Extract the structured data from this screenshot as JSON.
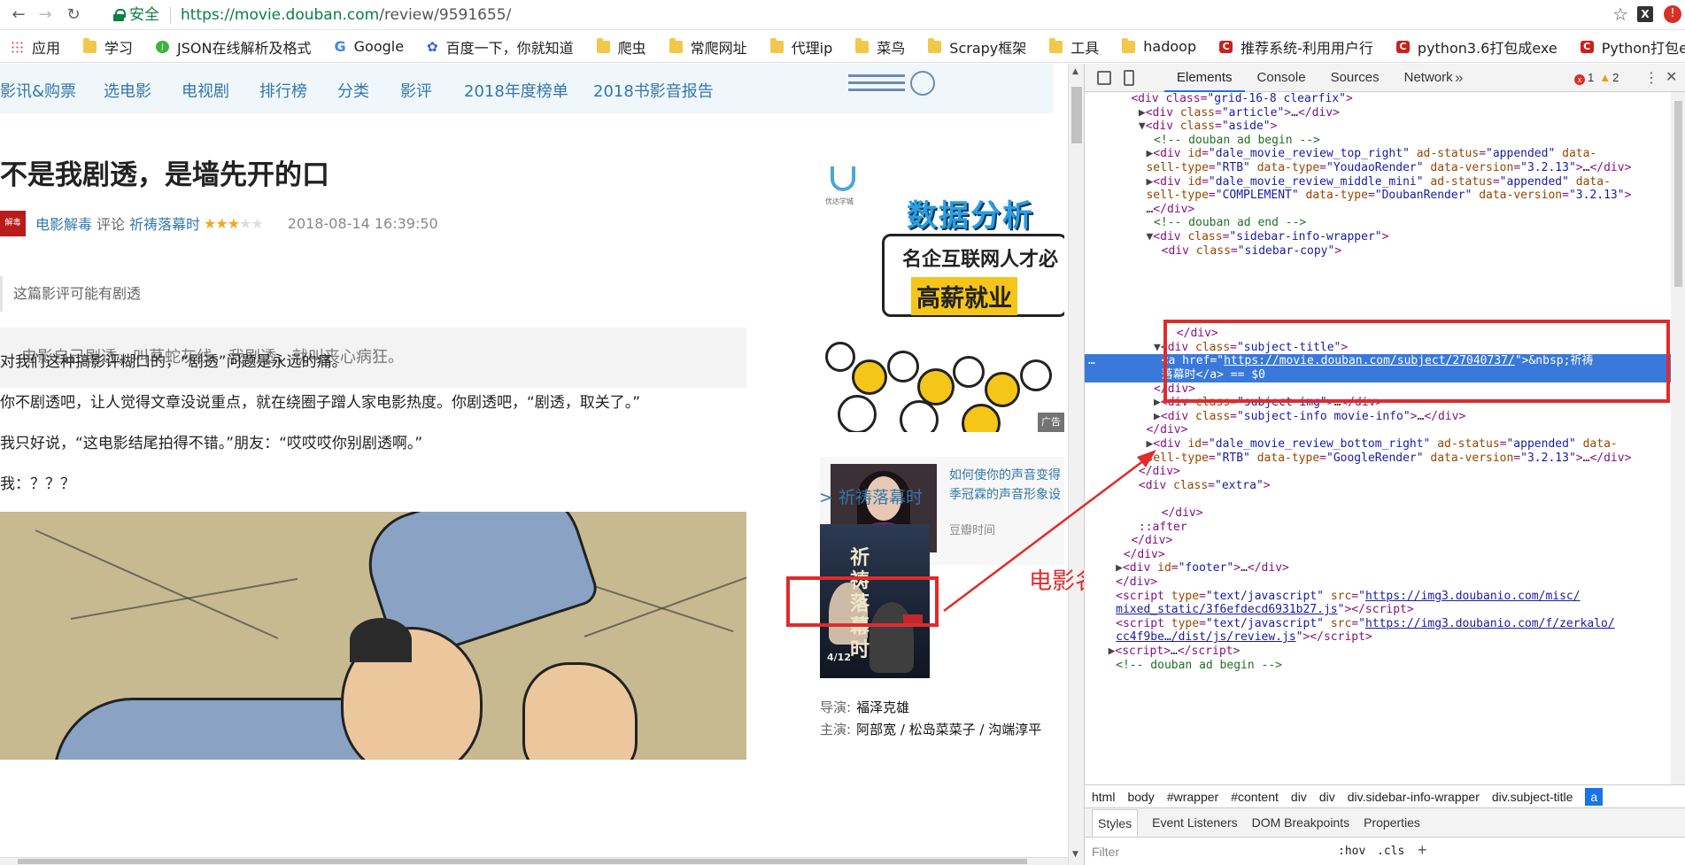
{
  "browser": {
    "secure_label": "安全",
    "url_host": "https://movie.douban.com",
    "url_path": "/review/9591655/",
    "bookmarks": [
      {
        "label": "应用",
        "icon": "apps-grid-icon"
      },
      {
        "label": "学习",
        "icon": "folder-icon"
      },
      {
        "label": "JSON在线解析及格式",
        "icon": "json-site-icon"
      },
      {
        "label": "Google",
        "icon": "google-icon"
      },
      {
        "label": "百度一下，你就知道",
        "icon": "baidu-icon"
      },
      {
        "label": "爬虫",
        "icon": "folder-icon"
      },
      {
        "label": "常爬网址",
        "icon": "folder-icon"
      },
      {
        "label": "代理ip",
        "icon": "folder-icon"
      },
      {
        "label": "菜鸟",
        "icon": "folder-icon"
      },
      {
        "label": "Scrapy框架",
        "icon": "folder-icon"
      },
      {
        "label": "工具",
        "icon": "folder-icon"
      },
      {
        "label": "hadoop",
        "icon": "folder-icon"
      },
      {
        "label": "推荐系统-利用用户行",
        "icon": "csdn-icon"
      },
      {
        "label": "python3.6打包成exe",
        "icon": "csdn-icon"
      },
      {
        "label": "Python打包exe文件",
        "icon": "csdn-icon"
      }
    ]
  },
  "page": {
    "nav": [
      "影讯&购票",
      "选电影",
      "电视剧",
      "排行榜",
      "分类",
      "影评",
      "2018年度榜单",
      "2018书影音报告"
    ],
    "review_title": "不是我剧透，是墙先开的口",
    "avatar_text": "解毒",
    "author": "电影解毒",
    "review_word": "评论",
    "movie": "祈祷落幕时",
    "rating": 3,
    "rating_max": 5,
    "date": "2018-08-14 16:39:50",
    "spoiler": "这篇影评可能有剧透",
    "quote": "电影自己剧透，叫草蛇灰线。我剧透，就叫丧心病狂。",
    "paragraphs": [
      "对我们这种搞影评糊口的，“剧透”问题是永远的痛。",
      "你不剧透吧，让人觉得文章没说重点，就在绕圈子蹭人家电影热度。你剧透吧，“剧透，取关了。”",
      "我只好说，“这电影结尾拍得不错。”朋友：“哎哎哎你别剧透啊。”",
      "我：？？？"
    ],
    "sidebar": {
      "ad_logo_text": "优达学城",
      "ad_title": "数据分析师",
      "ad_sub1": "名企互联网人才必",
      "ad_sub2": "高薪就业",
      "ad_badge": "广告",
      "ad2_line1": "如何使你的声音变得",
      "ad2_line2": "季冠霖的声音形象设",
      "ad2_source": "豆瓣时间",
      "subject_title": "> 祈祷落幕时",
      "poster_title": "祈祷落幕时",
      "poster_date": "4/12",
      "director_label": "导演:",
      "director": "福泽克雄",
      "cast_label": "主演:",
      "cast": "阿部宽 / 松岛菜菜子 / 沟端淳平"
    },
    "annotation": "电影名"
  },
  "devtools": {
    "tabs": [
      "Elements",
      "Console",
      "Sources",
      "Network"
    ],
    "more": "»",
    "errors": "1",
    "warnings": "2",
    "lines": [
      {
        "indent": 8,
        "html": "<span class='tg'>&lt;div class=</span><span class='av'>\"grid-16-8 clearfix\"</span><span class='tg'>&gt;</span>"
      },
      {
        "indent": 10,
        "tri": "▶",
        "html": "<span class='tg'>&lt;div </span><span class='an'>class</span><span class='tg'>=</span><span class='av'>\"article\"</span><span class='tg'>&gt;</span><span class='tx'>…</span><span class='tg'>&lt;/div&gt;</span>"
      },
      {
        "indent": 10,
        "tri": "▼",
        "html": "<span class='tg'>&lt;div </span><span class='an'>class</span><span class='tg'>=</span><span class='av'>\"aside\"</span><span class='tg'>&gt;</span>"
      },
      {
        "indent": 14,
        "html": "<span class='cm'>&lt;!-- douban ad begin --&gt;</span>"
      },
      {
        "indent": 12,
        "tri": "▶",
        "html": "<span class='tg'>&lt;div </span><span class='an'>id</span><span class='tg'>=</span><span class='av'>\"dale_movie_review_top_right\"</span> <span class='an'>ad-status</span><span class='tg'>=</span><span class='av'>\"appended\"</span> <span class='an'>data-</span>"
      },
      {
        "indent": 12,
        "html": "<span class='an'>sell-type</span><span class='tg'>=</span><span class='av'>\"RTB\"</span> <span class='an'>data-type</span><span class='tg'>=</span><span class='av'>\"YoudaoRender\"</span> <span class='an'>data-version</span><span class='tg'>=</span><span class='av'>\"3.2.13\"</span><span class='tg'>&gt;</span><span class='tx'>…</span><span class='tg'>&lt;/div&gt;</span>"
      },
      {
        "indent": 12,
        "tri": "▶",
        "html": "<span class='tg'>&lt;div </span><span class='an'>id</span><span class='tg'>=</span><span class='av'>\"dale_movie_review_middle_mini\"</span> <span class='an'>ad-status</span><span class='tg'>=</span><span class='av'>\"appended\"</span> <span class='an'>data-</span>"
      },
      {
        "indent": 12,
        "html": "<span class='an'>sell-type</span><span class='tg'>=</span><span class='av'>\"COMPLEMENT\"</span> <span class='an'>data-type</span><span class='tg'>=</span><span class='av'>\"DoubanRender\"</span> <span class='an'>data-version</span><span class='tg'>=</span><span class='av'>\"3.2.13\"</span><span class='tg'>&gt;</span>"
      },
      {
        "indent": 12,
        "html": "<span class='tx'>…</span><span class='tg'>&lt;/div&gt;</span>"
      },
      {
        "indent": 14,
        "html": "<span class='cm'>&lt;!-- douban ad end --&gt;</span>"
      },
      {
        "indent": 12,
        "tri": "▼",
        "html": "<span class='tg'>&lt;div </span><span class='an'>class</span><span class='tg'>=</span><span class='av'>\"sidebar-info-wrapper\"</span><span class='tg'>&gt;</span>"
      },
      {
        "indent": 16,
        "html": "<span class='tg'>&lt;div </span><span class='an'>class</span><span class='tg'>=</span><span class='av'>\"sidebar-copy\"</span><span class='tg'>&gt;</span>"
      },
      {
        "indent": 0,
        "html": ""
      },
      {
        "indent": 0,
        "html": ""
      },
      {
        "indent": 0,
        "html": ""
      },
      {
        "indent": 0,
        "html": ""
      },
      {
        "indent": 0,
        "html": ""
      },
      {
        "indent": 20,
        "html": "<span class='tg'>&lt;/div&gt;</span>"
      },
      {
        "indent": 14,
        "tri": "▼",
        "html": "<span class='tg'>&lt;div </span><span class='an'>class</span><span class='tg'>=</span><span class='av'>\"subject-title\"</span><span class='tg'>&gt;</span>"
      },
      {
        "indent": 16,
        "sel": true,
        "html": "<span class='tg'>&lt;a </span><span class='an'>href</span><span class='tg'>=</span><span class='av'>\"</span><span class='lk'>https://movie.douban.com/subject/27040737/</span><span class='av'>\"</span><span class='tg'>&gt;</span><span class='tx'>&amp;nbsp;祈祷</span>"
      },
      {
        "indent": 16,
        "sel": true,
        "html": "<span class='tx'>落幕时</span><span class='tg'>&lt;/a&gt;</span><span class='tx'> == $0</span>"
      },
      {
        "indent": 14,
        "html": "<span class='tg'>&lt;/div&gt;</span>"
      },
      {
        "indent": 14,
        "tri": "▶",
        "html": "<span class='tg'>&lt;div </span><span class='an'>class</span><span class='tg'>=</span><span class='av'>\"subject-img\"</span><span class='tg'>&gt;</span><span class='tx'>…</span><span class='tg'>&lt;/div&gt;</span>"
      },
      {
        "indent": 14,
        "tri": "▶",
        "html": "<span class='tg'>&lt;div </span><span class='an'>class</span><span class='tg'>=</span><span class='av'>\"subject-info movie-info\"</span><span class='tg'>&gt;</span><span class='tx'>…</span><span class='tg'>&lt;/div&gt;</span>"
      },
      {
        "indent": 12,
        "html": "<span class='tg'>&lt;/div&gt;</span>"
      },
      {
        "indent": 12,
        "tri": "▶",
        "html": "<span class='tg'>&lt;div </span><span class='an'>id</span><span class='tg'>=</span><span class='av'>\"dale_movie_review_bottom_right\"</span> <span class='an'>ad-status</span><span class='tg'>=</span><span class='av'>\"appended\"</span> <span class='an'>data-</span>"
      },
      {
        "indent": 12,
        "html": "<span class='an'>sell-type</span><span class='tg'>=</span><span class='av'>\"RTB\"</span> <span class='an'>data-type</span><span class='tg'>=</span><span class='av'>\"GoogleRender\"</span> <span class='an'>data-version</span><span class='tg'>=</span><span class='av'>\"3.2.13\"</span><span class='tg'>&gt;</span><span class='tx'>…</span><span class='tg'>&lt;/div&gt;</span>"
      },
      {
        "indent": 10,
        "html": "<span class='tg'>&lt;/div&gt;</span>"
      },
      {
        "indent": 10,
        "html": "<span class='tg'>&lt;div </span><span class='an'>class</span><span class='tg'>=</span><span class='av'>\"extra\"</span><span class='tg'>&gt;</span>"
      },
      {
        "indent": 0,
        "html": ""
      },
      {
        "indent": 16,
        "html": "<span class='tg'>&lt;/div&gt;</span>"
      },
      {
        "indent": 10,
        "html": "<span class='ps'>::after</span>"
      },
      {
        "indent": 8,
        "html": "<span class='tg'>&lt;/div&gt;</span>"
      },
      {
        "indent": 6,
        "html": "<span class='tg'>&lt;/div&gt;</span>"
      },
      {
        "indent": 4,
        "tri": "▶",
        "html": "<span class='tg'>&lt;div </span><span class='an'>id</span><span class='tg'>=</span><span class='av'>\"footer\"</span><span class='tg'>&gt;</span><span class='tx'>…</span><span class='tg'>&lt;/div&gt;</span>"
      },
      {
        "indent": 4,
        "html": "<span class='tg'>&lt;/div&gt;</span>"
      },
      {
        "indent": 4,
        "html": "<span class='tg'>&lt;script </span><span class='an'>type</span><span class='tg'>=</span><span class='av'>\"text/javascript\"</span> <span class='an'>src</span><span class='tg'>=</span><span class='av'>\"</span><span class='lk'>https://img3.doubanio.com/misc/</span>"
      },
      {
        "indent": 4,
        "html": "<span class='lk'>mixed_static/3f6efdecd6931b27.js</span><span class='av'>\"</span><span class='tg'>&gt;&lt;/script&gt;</span>"
      },
      {
        "indent": 4,
        "html": "<span class='tg'>&lt;script </span><span class='an'>type</span><span class='tg'>=</span><span class='av'>\"text/javascript\"</span> <span class='an'>src</span><span class='tg'>=</span><span class='av'>\"</span><span class='lk'>https://img3.doubanio.com/f/zerkalo/</span>"
      },
      {
        "indent": 4,
        "html": "<span class='lk'>cc4f9be…/dist/js/review.js</span><span class='av'>\"</span><span class='tg'>&gt;&lt;/script&gt;</span>"
      },
      {
        "indent": 2,
        "tri": "▶",
        "html": "<span class='tg'>&lt;script&gt;</span><span class='tx'>…</span><span class='tg'>&lt;/script&gt;</span>"
      },
      {
        "indent": 4,
        "html": "<span class='cm'>&lt;!-- douban ad begin --&gt;</span>"
      }
    ],
    "breadcrumbs": [
      "html",
      "body",
      "#wrapper",
      "#content",
      "div",
      "div",
      "div.sidebar-info-wrapper",
      "div.subject-title",
      "a"
    ],
    "subtabs": [
      "Styles",
      "Event Listeners",
      "DOM Breakpoints",
      "Properties"
    ],
    "filter_placeholder": "Filter",
    "hov": ":hov",
    "cls": ".cls",
    "plus": "+",
    "ellipsis": "…"
  }
}
